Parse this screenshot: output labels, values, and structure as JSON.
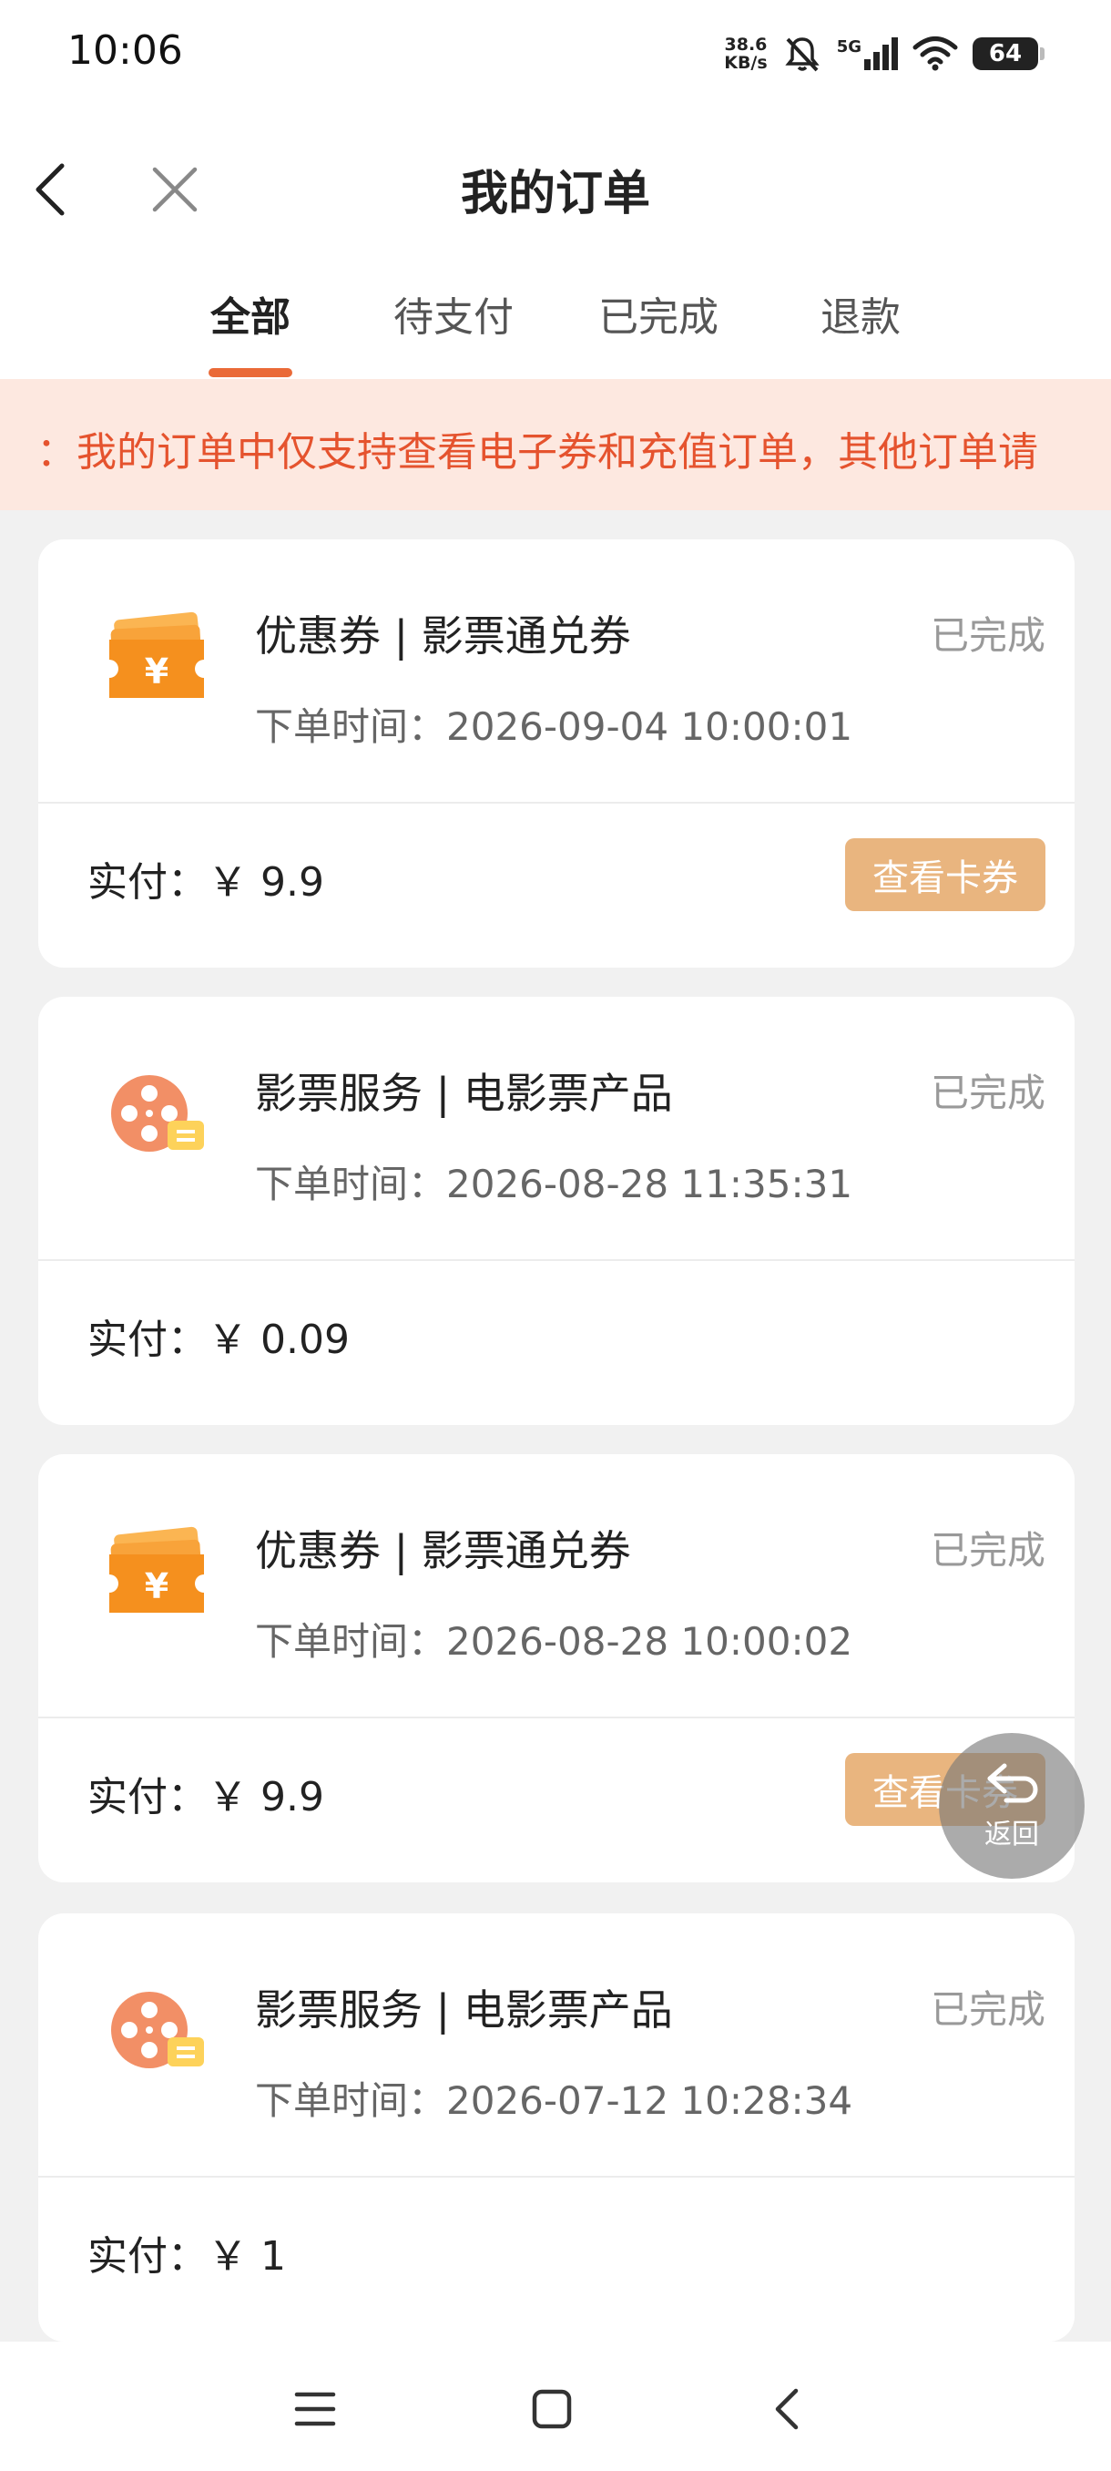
{
  "status_bar": {
    "time": "10:06",
    "net_speed_value": "38.6",
    "net_speed_unit": "KB/s",
    "network": "5G",
    "battery": "64"
  },
  "header": {
    "title": "我的订单"
  },
  "tabs": [
    {
      "label": "全部",
      "active": true
    },
    {
      "label": "待支付",
      "active": false
    },
    {
      "label": "已完成",
      "active": false
    },
    {
      "label": "退款",
      "active": false
    }
  ],
  "notice": {
    "text": "：我的订单中仅支持查看电子券和充值订单，其他订单请"
  },
  "orders": [
    {
      "title": "优惠券 | 影票通兑券",
      "status": "已完成",
      "time": "下单时间：2026-09-04 10:00:01",
      "paid": "实付：￥ 9.9",
      "button": "查看卡券",
      "icon": "coupon-icon"
    },
    {
      "title": "影票服务 | 电影票产品",
      "status": "已完成",
      "time": "下单时间：2026-08-28 11:35:31",
      "paid": "实付：￥ 0.09",
      "button": "",
      "icon": "film-reel-icon"
    },
    {
      "title": "优惠券 | 影票通兑券",
      "status": "已完成",
      "time": "下单时间：2026-08-28 10:00:02",
      "paid": "实付：￥ 9.9",
      "button": "查看卡券",
      "icon": "coupon-icon"
    },
    {
      "title": "影票服务 | 电影票产品",
      "status": "已完成",
      "time": "下单时间：2026-07-12 10:28:34",
      "paid": "实付：￥ 1",
      "button": "",
      "icon": "film-reel-icon"
    }
  ],
  "float_button": {
    "label": "返回"
  },
  "colors": {
    "accent": "#ea6a38",
    "notice_text": "#e5532e",
    "notice_bg": "#fde8e0",
    "button_bg": "#e9b57f",
    "coupon_icon": "#f5901e",
    "film_icon": "#f28f66"
  }
}
